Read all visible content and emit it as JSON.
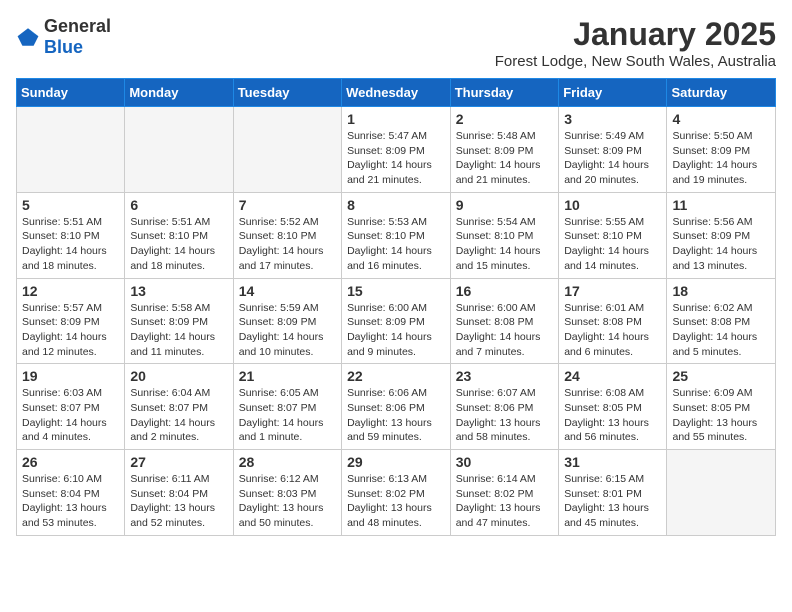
{
  "header": {
    "logo_general": "General",
    "logo_blue": "Blue",
    "title": "January 2025",
    "subtitle": "Forest Lodge, New South Wales, Australia"
  },
  "days_of_week": [
    "Sunday",
    "Monday",
    "Tuesday",
    "Wednesday",
    "Thursday",
    "Friday",
    "Saturday"
  ],
  "weeks": [
    [
      {
        "num": "",
        "info": ""
      },
      {
        "num": "",
        "info": ""
      },
      {
        "num": "",
        "info": ""
      },
      {
        "num": "1",
        "info": "Sunrise: 5:47 AM\nSunset: 8:09 PM\nDaylight: 14 hours and 21 minutes."
      },
      {
        "num": "2",
        "info": "Sunrise: 5:48 AM\nSunset: 8:09 PM\nDaylight: 14 hours and 21 minutes."
      },
      {
        "num": "3",
        "info": "Sunrise: 5:49 AM\nSunset: 8:09 PM\nDaylight: 14 hours and 20 minutes."
      },
      {
        "num": "4",
        "info": "Sunrise: 5:50 AM\nSunset: 8:09 PM\nDaylight: 14 hours and 19 minutes."
      }
    ],
    [
      {
        "num": "5",
        "info": "Sunrise: 5:51 AM\nSunset: 8:10 PM\nDaylight: 14 hours and 18 minutes."
      },
      {
        "num": "6",
        "info": "Sunrise: 5:51 AM\nSunset: 8:10 PM\nDaylight: 14 hours and 18 minutes."
      },
      {
        "num": "7",
        "info": "Sunrise: 5:52 AM\nSunset: 8:10 PM\nDaylight: 14 hours and 17 minutes."
      },
      {
        "num": "8",
        "info": "Sunrise: 5:53 AM\nSunset: 8:10 PM\nDaylight: 14 hours and 16 minutes."
      },
      {
        "num": "9",
        "info": "Sunrise: 5:54 AM\nSunset: 8:10 PM\nDaylight: 14 hours and 15 minutes."
      },
      {
        "num": "10",
        "info": "Sunrise: 5:55 AM\nSunset: 8:10 PM\nDaylight: 14 hours and 14 minutes."
      },
      {
        "num": "11",
        "info": "Sunrise: 5:56 AM\nSunset: 8:09 PM\nDaylight: 14 hours and 13 minutes."
      }
    ],
    [
      {
        "num": "12",
        "info": "Sunrise: 5:57 AM\nSunset: 8:09 PM\nDaylight: 14 hours and 12 minutes."
      },
      {
        "num": "13",
        "info": "Sunrise: 5:58 AM\nSunset: 8:09 PM\nDaylight: 14 hours and 11 minutes."
      },
      {
        "num": "14",
        "info": "Sunrise: 5:59 AM\nSunset: 8:09 PM\nDaylight: 14 hours and 10 minutes."
      },
      {
        "num": "15",
        "info": "Sunrise: 6:00 AM\nSunset: 8:09 PM\nDaylight: 14 hours and 9 minutes."
      },
      {
        "num": "16",
        "info": "Sunrise: 6:00 AM\nSunset: 8:08 PM\nDaylight: 14 hours and 7 minutes."
      },
      {
        "num": "17",
        "info": "Sunrise: 6:01 AM\nSunset: 8:08 PM\nDaylight: 14 hours and 6 minutes."
      },
      {
        "num": "18",
        "info": "Sunrise: 6:02 AM\nSunset: 8:08 PM\nDaylight: 14 hours and 5 minutes."
      }
    ],
    [
      {
        "num": "19",
        "info": "Sunrise: 6:03 AM\nSunset: 8:07 PM\nDaylight: 14 hours and 4 minutes."
      },
      {
        "num": "20",
        "info": "Sunrise: 6:04 AM\nSunset: 8:07 PM\nDaylight: 14 hours and 2 minutes."
      },
      {
        "num": "21",
        "info": "Sunrise: 6:05 AM\nSunset: 8:07 PM\nDaylight: 14 hours and 1 minute."
      },
      {
        "num": "22",
        "info": "Sunrise: 6:06 AM\nSunset: 8:06 PM\nDaylight: 13 hours and 59 minutes."
      },
      {
        "num": "23",
        "info": "Sunrise: 6:07 AM\nSunset: 8:06 PM\nDaylight: 13 hours and 58 minutes."
      },
      {
        "num": "24",
        "info": "Sunrise: 6:08 AM\nSunset: 8:05 PM\nDaylight: 13 hours and 56 minutes."
      },
      {
        "num": "25",
        "info": "Sunrise: 6:09 AM\nSunset: 8:05 PM\nDaylight: 13 hours and 55 minutes."
      }
    ],
    [
      {
        "num": "26",
        "info": "Sunrise: 6:10 AM\nSunset: 8:04 PM\nDaylight: 13 hours and 53 minutes."
      },
      {
        "num": "27",
        "info": "Sunrise: 6:11 AM\nSunset: 8:04 PM\nDaylight: 13 hours and 52 minutes."
      },
      {
        "num": "28",
        "info": "Sunrise: 6:12 AM\nSunset: 8:03 PM\nDaylight: 13 hours and 50 minutes."
      },
      {
        "num": "29",
        "info": "Sunrise: 6:13 AM\nSunset: 8:02 PM\nDaylight: 13 hours and 48 minutes."
      },
      {
        "num": "30",
        "info": "Sunrise: 6:14 AM\nSunset: 8:02 PM\nDaylight: 13 hours and 47 minutes."
      },
      {
        "num": "31",
        "info": "Sunrise: 6:15 AM\nSunset: 8:01 PM\nDaylight: 13 hours and 45 minutes."
      },
      {
        "num": "",
        "info": ""
      }
    ]
  ]
}
